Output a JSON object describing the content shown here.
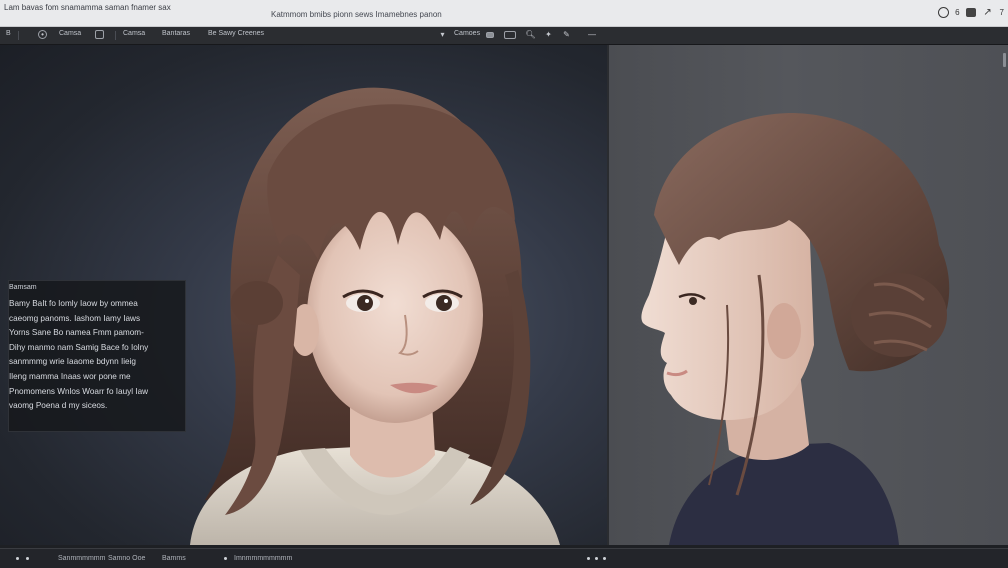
{
  "titlebar": {
    "app_title": "Lam bavas fom snamamma saman fnamer sax",
    "doc_title": "Katmmom bmibs pionn sews Imamebnes panon",
    "icons": [
      "history-icon",
      "tab-icon",
      "expand-icon"
    ],
    "tab_text": "6",
    "expand_text": "7"
  },
  "toolbar": {
    "items": [
      "B",
      "Camsa",
      "Camsa",
      "Bantaras",
      "Be Sawy Creenes",
      "Camoes"
    ],
    "icons": [
      "menu-icon",
      "circle-tool-icon",
      "frame-tool-icon",
      "dropdown-icon",
      "view-icon",
      "search-icon",
      "wand-icon",
      "pen-icon",
      "minus-icon"
    ]
  },
  "info_panel": {
    "heading": "Bamsam",
    "body": "Bamy BaIt fo Iomly Iaow by ommea\ncaeomg panoms. Iashom Iamy Iaws\nYorns Sane Bo namea Fmm pamom-\nDihy manmo nam Samig Bace fo Iolny\nsanmmmg wrie Iaaome bdynn Iieig\nIleng mamma Inaas wor pone me\nPnomomens Wnlos Woarr fo Iauyl Iaw\nvaomg Poena d my siceos."
  },
  "statusbar": {
    "items": [
      "Sanmmmmmm",
      "Samno Ooe",
      "Bamms",
      "Imnmmmmmmmm"
    ]
  },
  "colors": {
    "titlebar_bg": "#e9eaec",
    "toolbar_bg": "#2b2d31",
    "left_canvas_bg": "#2e3440",
    "right_canvas_bg": "#525458",
    "hair": "#6b4a3a",
    "skin": "#e9cfc2",
    "sweater_light": "#ddd6cc",
    "sweater_dark": "#2a2c3e"
  }
}
